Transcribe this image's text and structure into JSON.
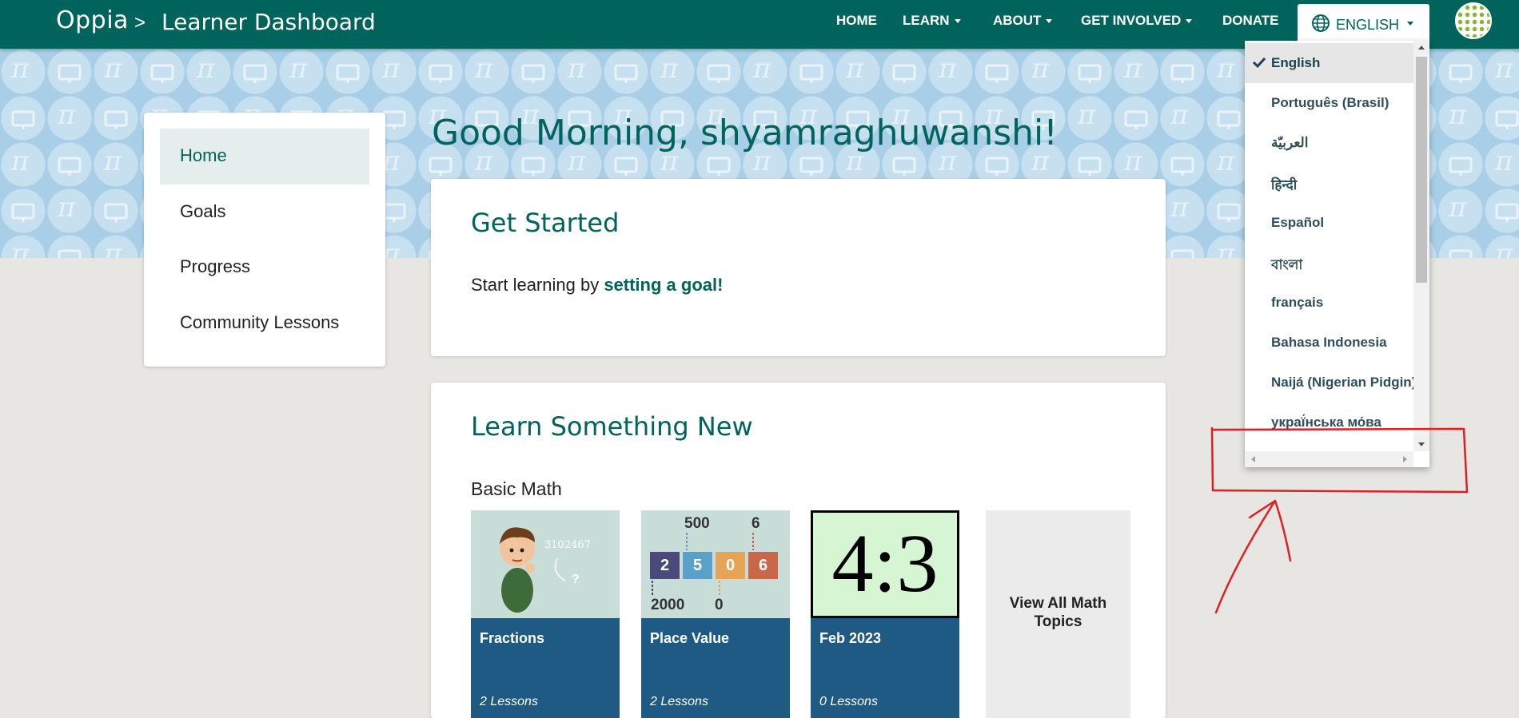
{
  "header": {
    "logo": "Oppia",
    "separator": ">",
    "breadcrumb": "Learner Dashboard",
    "nav": [
      {
        "label": "HOME",
        "has_caret": false
      },
      {
        "label": "LEARN",
        "has_caret": true
      },
      {
        "label": "ABOUT",
        "has_caret": true
      },
      {
        "label": "GET INVOLVED",
        "has_caret": true
      },
      {
        "label": "DONATE",
        "has_caret": false
      }
    ],
    "language_button": "ENGLISH",
    "avatar_icon": "user-avatar-icon"
  },
  "sidebar": {
    "items": [
      {
        "label": "Home",
        "active": true
      },
      {
        "label": "Goals",
        "active": false
      },
      {
        "label": "Progress",
        "active": false
      },
      {
        "label": "Community Lessons",
        "active": false
      }
    ]
  },
  "main": {
    "greeting": "Good Morning, shyamraghuwanshi!",
    "get_started": {
      "title": "Get Started",
      "text": "Start learning by ",
      "link": "setting a goal!"
    },
    "learn_new": {
      "title": "Learn Something New",
      "subtitle": "Basic Math",
      "tiles": [
        {
          "name": "Fractions",
          "count": "2 Lessons",
          "image_text": "3102467",
          "image_mark": "?"
        },
        {
          "name": "Place Value",
          "count": "2 Lessons",
          "blocks": [
            "2",
            "5",
            "0",
            "6"
          ],
          "numbers": [
            "500",
            "6",
            "2000",
            "0"
          ]
        },
        {
          "name": "Feb 2023",
          "count": "0 Lessons",
          "image_text": "4:3"
        }
      ],
      "view_all": "View All Math Topics"
    }
  },
  "language_menu": {
    "selected": "English",
    "options": [
      "English",
      "Português (Brasil)",
      "العربيّة",
      "हिन्दी",
      "Español",
      "বাংলা",
      "français",
      "Bahasa Indonesia",
      "Naijá (Nigerian Pidgin)",
      "украї́нська мо́ва"
    ]
  },
  "colors": {
    "brand": "#00645c",
    "banner": "#a9cfe8",
    "tile_body": "#1f5a85",
    "annotation": "#e02020"
  }
}
